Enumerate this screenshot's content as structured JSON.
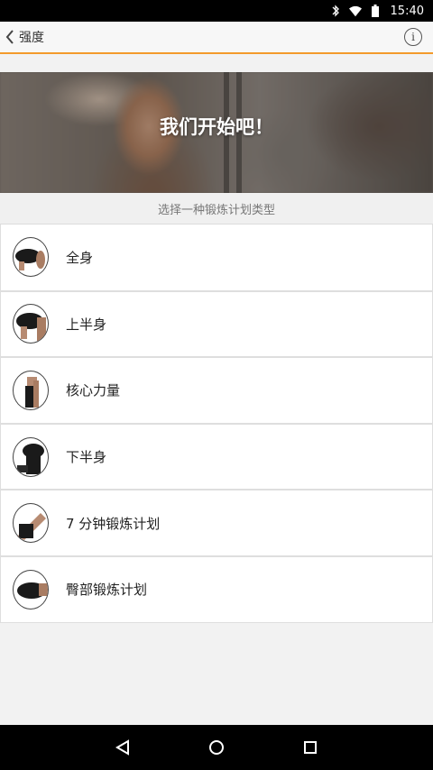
{
  "status": {
    "time": "15:40"
  },
  "toolbar": {
    "title": "强度",
    "info_glyph": "i"
  },
  "hero": {
    "headline": "我们开始吧！"
  },
  "subheader": "选择一种锻炼计划类型",
  "workouts": [
    {
      "label": "全身",
      "icon": "full-body-icon"
    },
    {
      "label": "上半身",
      "icon": "upper-body-icon"
    },
    {
      "label": "核心力量",
      "icon": "core-icon"
    },
    {
      "label": "下半身",
      "icon": "lower-body-icon"
    },
    {
      "label": "7 分钟锻炼计划",
      "icon": "seven-minute-icon"
    },
    {
      "label": "臀部锻炼计划",
      "icon": "glutes-icon"
    }
  ],
  "colors": {
    "accent": "#f39a2b"
  }
}
